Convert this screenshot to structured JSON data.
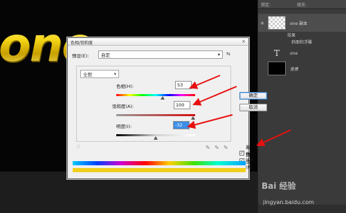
{
  "canvas": {
    "text": "one"
  },
  "layers_panel": {
    "top_labels": [
      "锁定:",
      "填充:"
    ],
    "layers": [
      {
        "name": "one 副本",
        "effects_label": "效果",
        "effect": "斜面和浮雕"
      },
      {
        "name": "one"
      },
      {
        "name": "背景"
      }
    ]
  },
  "dialog": {
    "title": "色相/饱和度",
    "close": "×",
    "preset_label": "预设(E):",
    "preset_value": "自定",
    "edit_value": "全图",
    "ok_label": "确定",
    "cancel_label": "取消",
    "hue_label": "色相(H):",
    "hue_value": "53",
    "saturation_label": "饱和度(A):",
    "saturation_value": "100",
    "lightness_label": "明度(I):",
    "lightness_value": "-32",
    "colorize_label": "着色(O)",
    "preview_label": "预览(P)",
    "colorize_checked": true,
    "preview_checked": true
  },
  "watermark": {
    "brand": "Bai 经验",
    "url": "jingyan.baidu.com"
  }
}
